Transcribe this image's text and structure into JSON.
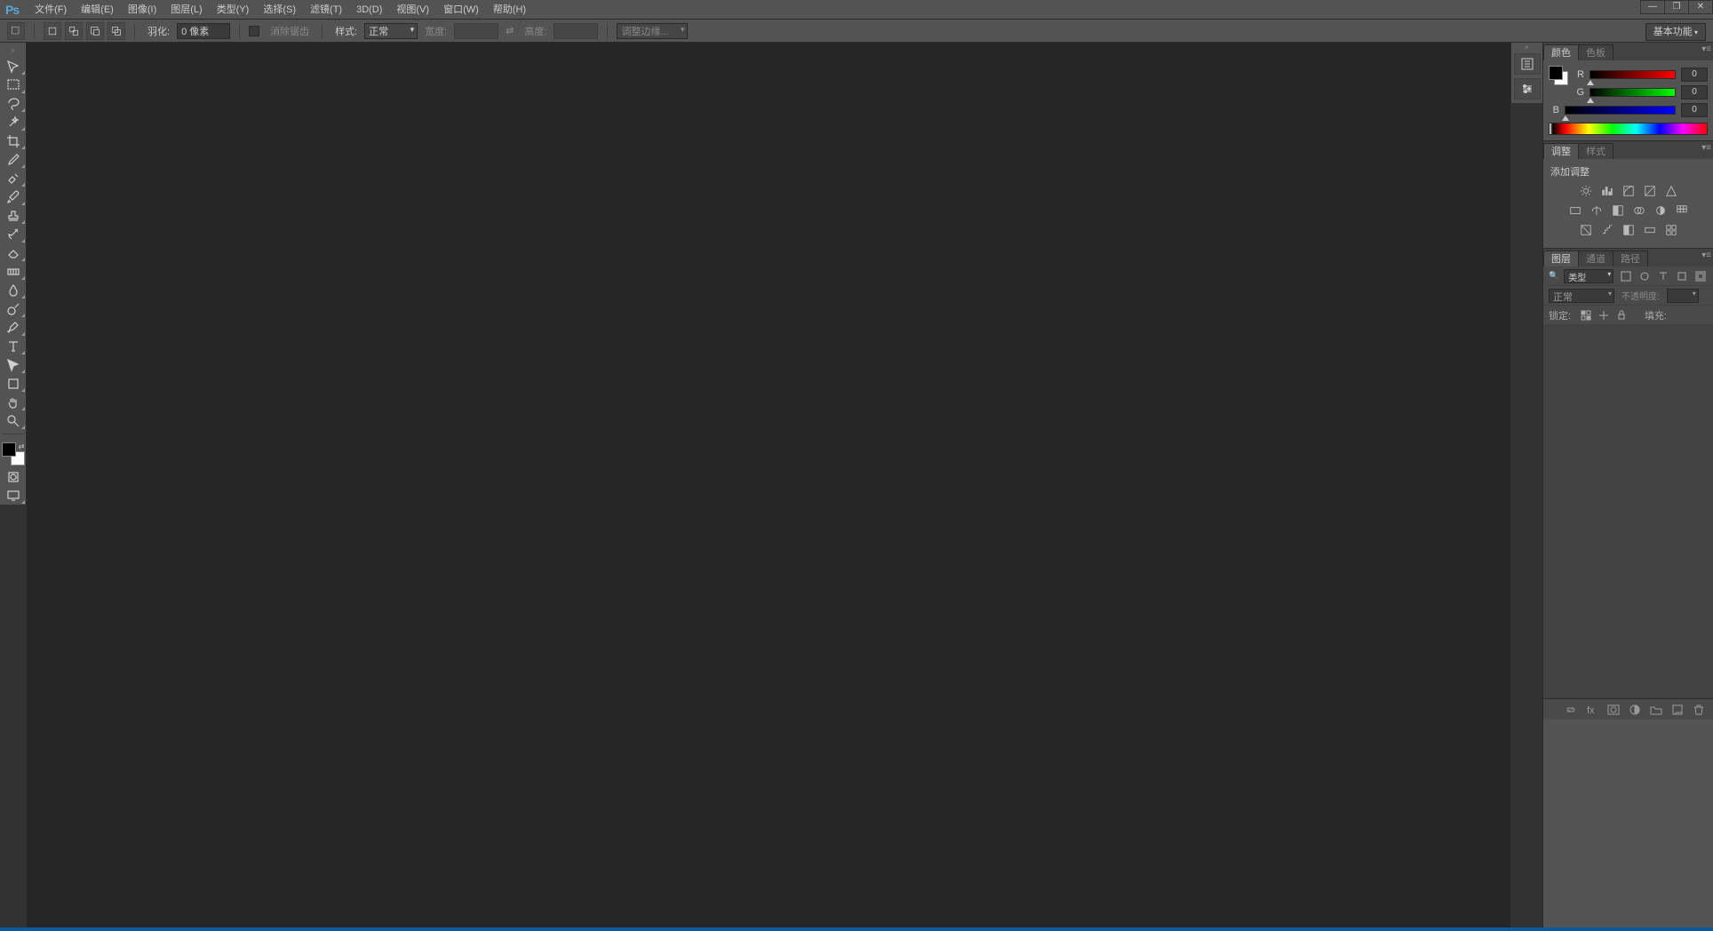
{
  "app": {
    "logo": "Ps"
  },
  "menu": {
    "items": [
      "文件(F)",
      "编辑(E)",
      "图像(I)",
      "图层(L)",
      "类型(Y)",
      "选择(S)",
      "滤镜(T)",
      "3D(D)",
      "视图(V)",
      "窗口(W)",
      "帮助(H)"
    ]
  },
  "window_controls": {
    "min": "—",
    "max": "❐",
    "close": "✕"
  },
  "options": {
    "feather_label": "羽化:",
    "feather_value": "0 像素",
    "antialias_label": "消除锯齿",
    "style_label": "样式:",
    "style_value": "正常",
    "width_label": "宽度:",
    "height_label": "高度:",
    "refine_edge": "调整边缘...",
    "workspace": "基本功能"
  },
  "tools": [
    "move",
    "marquee",
    "lasso",
    "wand",
    "crop",
    "eyedropper",
    "healing",
    "brush",
    "stamp",
    "history",
    "eraser",
    "gradient",
    "blur",
    "dodge",
    "pen",
    "type",
    "path",
    "shape",
    "hand",
    "zoom"
  ],
  "color": {
    "tab1": "颜色",
    "tab2": "色板",
    "r_label": "R",
    "g_label": "G",
    "b_label": "B",
    "r": "0",
    "g": "0",
    "b": "0"
  },
  "adjust": {
    "tab1": "调整",
    "tab2": "样式",
    "title": "添加调整"
  },
  "layers": {
    "tab1": "图层",
    "tab2": "通道",
    "tab3": "路径",
    "filter_kind": "类型",
    "blend": "正常",
    "opacity_label": "不透明度:",
    "lock_label": "锁定:",
    "fill_label": "填充:"
  }
}
